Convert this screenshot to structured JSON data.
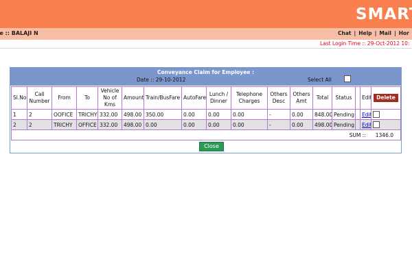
{
  "header": {
    "brand": "SMART",
    "user_label": "me :: BALAJI N",
    "links": [
      "Chat",
      "Help",
      "Mail",
      "Hor"
    ],
    "last_login": "Last Login Time :: 29-Oct-2012 10:"
  },
  "claim": {
    "title": "Conveyance Claim for Employee :",
    "date_text": "Date :: 29-10-2012",
    "select_all_label": "Select All",
    "columns": [
      "Sl.No",
      "Call Number",
      "From",
      "To",
      "Vehicle No of Kms",
      "Amount",
      "Train/BusFare",
      "AutoFare",
      "Lunch / Dinner",
      "Telephone Charges",
      "Others Desc",
      "Others Amt",
      "Total",
      "Status",
      "",
      "Edit"
    ],
    "delete_label": "Delete",
    "rows": [
      {
        "sl": "1",
        "call": "2",
        "from": "OOFICE",
        "to": "TRICHY",
        "kms": "332.00",
        "amount": "498.00",
        "train": "350.00",
        "auto": "0.00",
        "lunch": "0.00",
        "tel": "0.00",
        "odesc": "-",
        "oamt": "0.00",
        "total": "848.00",
        "status": "Pending",
        "edit": "Edit"
      },
      {
        "sl": "2",
        "call": "2",
        "from": "TRICHY",
        "to": "OFFICE",
        "kms": "332.00",
        "amount": "498.00",
        "train": "0.00",
        "auto": "0.00",
        "lunch": "0.00",
        "tel": "0.00",
        "odesc": "-",
        "oamt": "0.00",
        "total": "498.00",
        "status": "Pending",
        "edit": "Edit"
      }
    ],
    "sum_label": "SUM ::",
    "sum_value": "1346.0",
    "close_label": "Close"
  },
  "colors": {
    "top_bar": "#f97f4f",
    "user_bar": "#f8bda5",
    "panel_header": "#7b96cc",
    "grid_border": "#b07acb",
    "delete_button": "#a12c20",
    "close_button": "#2c9a54",
    "last_login_text": "#e0001a"
  }
}
